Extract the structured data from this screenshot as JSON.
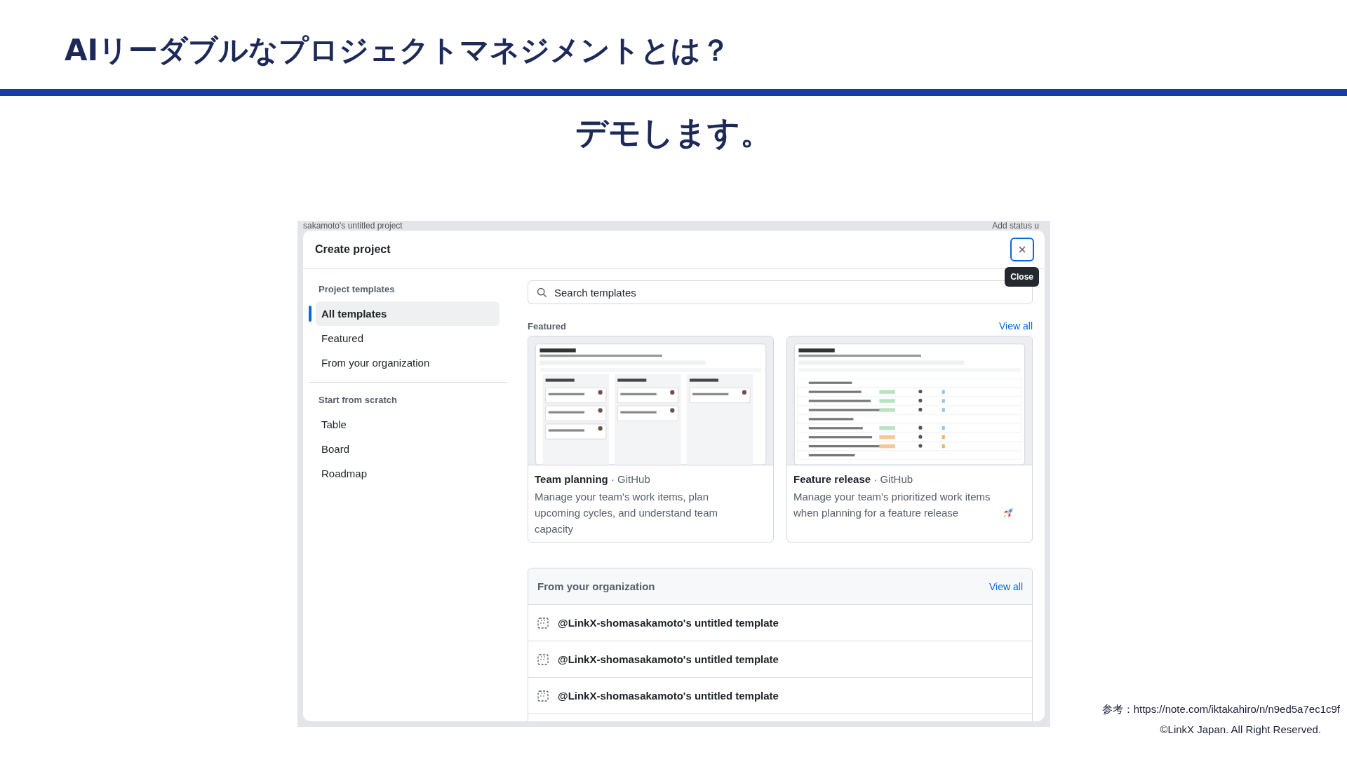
{
  "slide": {
    "title": "AIリーダブルなプロジェクトマネジメントとは？",
    "subtitle": "デモします。"
  },
  "screenshot": {
    "background": {
      "project_title": "sakamoto's untitled project",
      "status_button": "Add status u"
    },
    "dialog": {
      "title": "Create project",
      "close_tooltip": "Close",
      "sidebar": [
        {
          "heading": "Project templates",
          "items": [
            {
              "label": "All templates",
              "selected": true
            },
            {
              "label": "Featured",
              "selected": false
            },
            {
              "label": "From your organization",
              "selected": false
            }
          ]
        },
        {
          "heading": "Start from scratch",
          "items": [
            {
              "label": "Table",
              "selected": false
            },
            {
              "label": "Board",
              "selected": false
            },
            {
              "label": "Roadmap",
              "selected": false
            }
          ]
        }
      ],
      "search": {
        "placeholder": "Search templates"
      },
      "featured": {
        "heading": "Featured",
        "link": "View all",
        "cards": [
          {
            "name": "Team planning",
            "byline": "· GitHub",
            "description": "Manage your team's work items, plan upcoming cycles, and understand team capacity",
            "kind": "board",
            "rocket": false
          },
          {
            "name": "Feature release",
            "byline": "· GitHub",
            "description": "Manage your team's prioritized work items when planning for a feature release",
            "kind": "table",
            "rocket": true
          }
        ]
      },
      "organization": {
        "heading": "From your organization",
        "link": "View all",
        "templates": [
          "@LinkX-shomasakamoto's untitled template",
          "@LinkX-shomasakamoto's untitled template",
          "@LinkX-shomasakamoto's untitled template"
        ]
      }
    }
  },
  "footer": {
    "reference": "参考：https://note.com/iktakahiro/n/n9ed5a7ec1c9f",
    "copyright": "©LinkX Japan. All Right Reserved."
  }
}
